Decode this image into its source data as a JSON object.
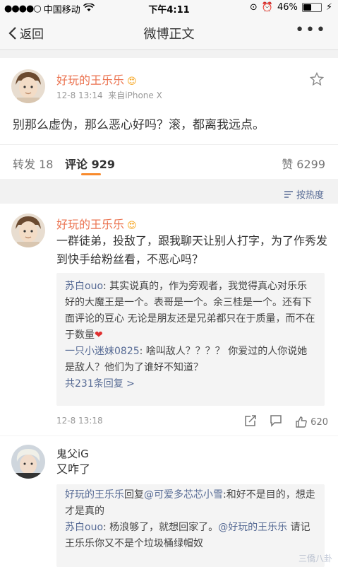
{
  "status_bar": {
    "carrier": "中国移动",
    "time": "下午4:11",
    "battery": "46%",
    "battery_level": 0.46
  },
  "nav": {
    "back_label": "返回",
    "title": "微博正文"
  },
  "post": {
    "author": "好玩的王乐乐",
    "time": "12-8 13:14",
    "source": "来自iPhone X",
    "text": "别那么虚伪，那么恶心好吗？滚，都离我远点。"
  },
  "tabs": {
    "repost": "转发 18",
    "comments": "评论 929",
    "likes": "赞 6299"
  },
  "sort_label": "按热度",
  "comments": [
    {
      "author": "好玩的王乐乐",
      "text": "一群徒弟，投敌了，跟我聊天让别人打字，为了作秀发到快手给粉丝看，不恶心吗？",
      "replies": [
        {
          "user": "苏白ouo",
          "text": ": 其实说真的，作为旁观者，我觉得真心对乐乐好的大魔王是一个。表哥是一个。余三桂是一个。还有下面评论的豆心 无论是朋友还是兄弟都只在于质量，而不在于数量"
        },
        {
          "user": "一只小迷妹0825",
          "text": ": 啥叫敌人？？？？ 你爱过的人你说她是敌人？他们为了谁好不知道？"
        }
      ],
      "more_replies": "共231条回复 >",
      "time": "12-8 13:18",
      "likes": "620"
    },
    {
      "author": "鬼父iG",
      "text": "又咋了",
      "replies": [
        {
          "user": "好玩的王乐乐",
          "mid": "回复",
          "target": "@可爱多芯芯小雪",
          "text": ":和好不是目的，想走才是真的"
        },
        {
          "user": "苏白ouo",
          "text": ": 杨浪够了，就想回家了。",
          "target": "@好玩的王乐乐",
          "tail": " 请记王乐乐你又不是个垃圾桶绿帽奴"
        }
      ]
    }
  ],
  "watermark": "三僑八卦"
}
